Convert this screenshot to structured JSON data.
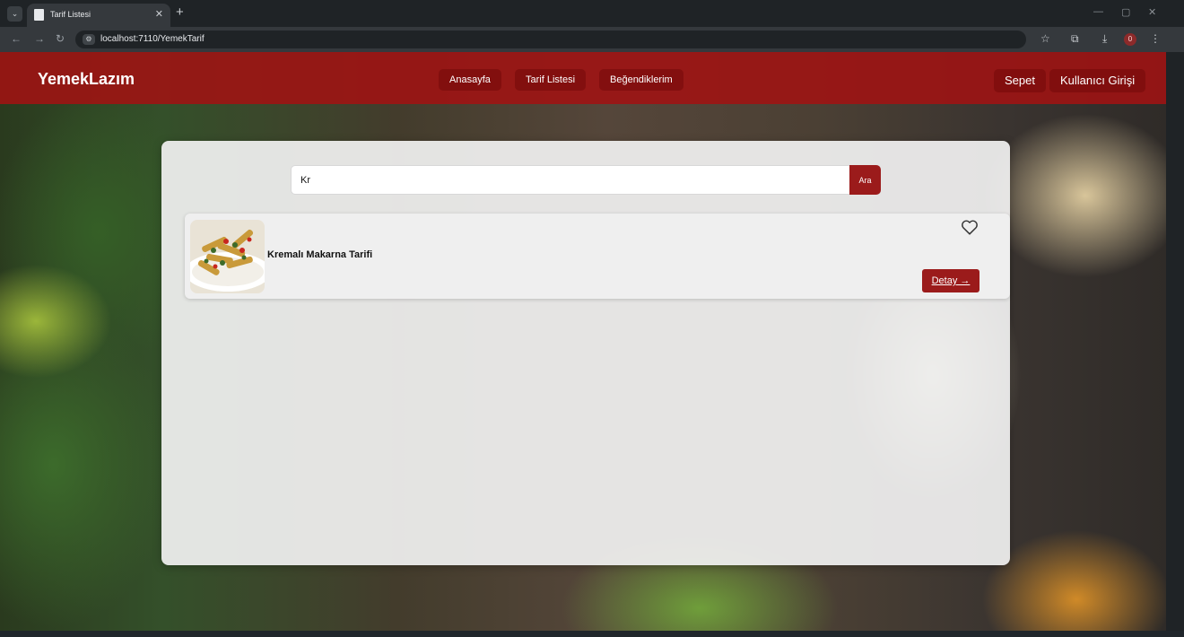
{
  "browser": {
    "tab_title": "Tarif Listesi",
    "url": "localhost:7110/YemekTarif",
    "colors": {
      "frame": "#1f2326",
      "toolbar": "#35393d"
    },
    "badge_count": "0"
  },
  "navbar": {
    "brand": "YemekLazım",
    "links": [
      "Anasayfa",
      "Tarif Listesi",
      "Beğendiklerim"
    ],
    "cart_label": "Sepet",
    "login_label": "Kullanıcı Girişi"
  },
  "search": {
    "value": "Kr",
    "button_label": "Ara"
  },
  "results": [
    {
      "title": "Kremalı Makarna Tarifi",
      "image_icon": "pasta-dish-image",
      "favorite_icon": "heart-outline-icon",
      "detail_label": "Detay →"
    }
  ],
  "colors": {
    "navbar_bg": "#a01212",
    "accent": "#9b1b1b",
    "panel_bg": "#f2f2f2"
  }
}
